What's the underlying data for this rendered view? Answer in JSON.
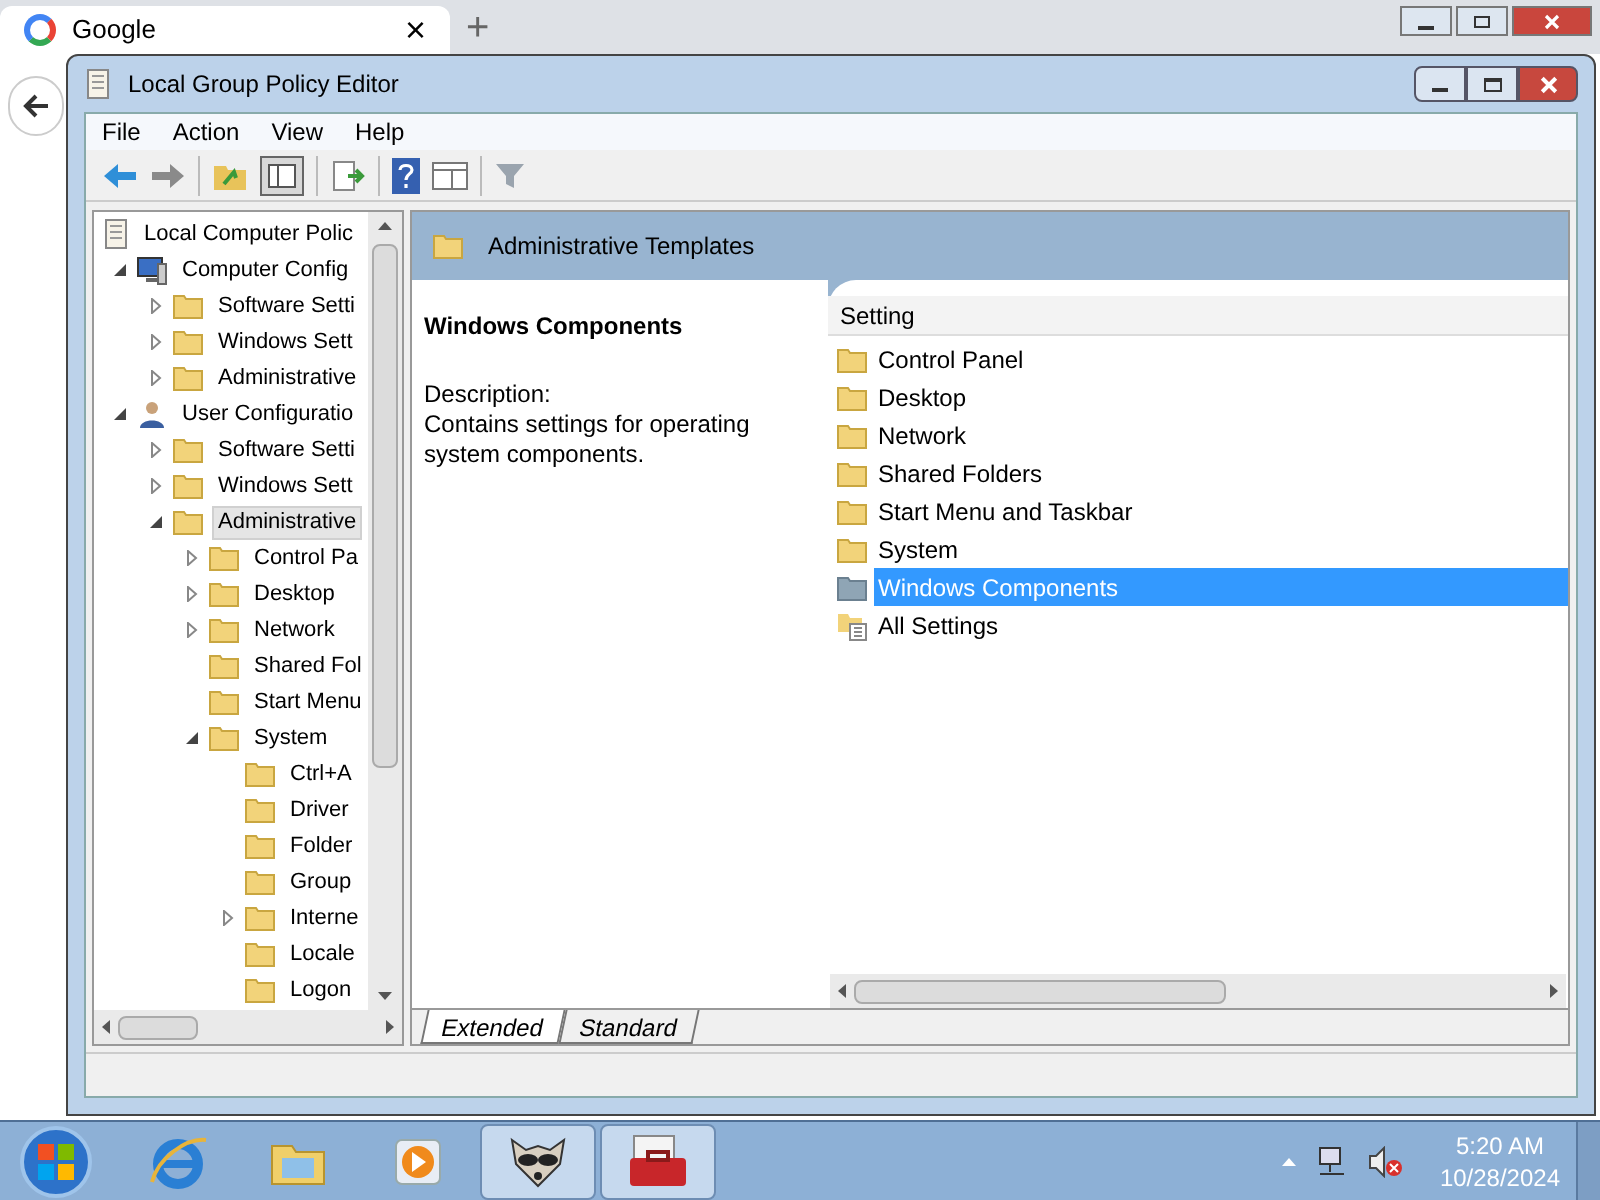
{
  "browser": {
    "tab_title": "Google",
    "tab_close": "×",
    "new_tab": "+"
  },
  "window": {
    "title": "Local Group Policy Editor"
  },
  "menu": [
    "File",
    "Action",
    "View",
    "Help"
  ],
  "tree": [
    {
      "label": "Local Computer Polic",
      "kind": "policy",
      "expandable": false,
      "selected": false,
      "children": [
        {
          "label": "Computer Config",
          "kind": "computer",
          "expandable": true,
          "expanded": true,
          "selected": false,
          "children": [
            {
              "label": "Software Setti",
              "kind": "folder",
              "expandable": true,
              "expanded": false,
              "selected": false
            },
            {
              "label": "Windows Sett",
              "kind": "folder",
              "expandable": true,
              "expanded": false,
              "selected": false
            },
            {
              "label": "Administrative",
              "kind": "folder",
              "expandable": true,
              "expanded": false,
              "selected": false
            }
          ]
        },
        {
          "label": "User Configuratio",
          "kind": "user",
          "expandable": true,
          "expanded": true,
          "selected": false,
          "children": [
            {
              "label": "Software Setti",
              "kind": "folder",
              "expandable": true,
              "expanded": false,
              "selected": false
            },
            {
              "label": "Windows Sett",
              "kind": "folder",
              "expandable": true,
              "expanded": false,
              "selected": false
            },
            {
              "label": "Administrative",
              "kind": "folder",
              "expandable": true,
              "expanded": true,
              "selected": true,
              "children": [
                {
                  "label": "Control Pa",
                  "kind": "folder",
                  "expandable": true,
                  "expanded": false,
                  "selected": false
                },
                {
                  "label": "Desktop",
                  "kind": "folder",
                  "expandable": true,
                  "expanded": false,
                  "selected": false
                },
                {
                  "label": "Network",
                  "kind": "folder",
                  "expandable": true,
                  "expanded": false,
                  "selected": false
                },
                {
                  "label": "Shared Fol",
                  "kind": "folder",
                  "expandable": false,
                  "selected": false
                },
                {
                  "label": "Start Menu",
                  "kind": "folder",
                  "expandable": false,
                  "selected": false
                },
                {
                  "label": "System",
                  "kind": "folder",
                  "expandable": true,
                  "expanded": true,
                  "selected": false,
                  "children": [
                    {
                      "label": "Ctrl+A",
                      "kind": "folder",
                      "expandable": false,
                      "selected": false
                    },
                    {
                      "label": "Driver",
                      "kind": "folder",
                      "expandable": false,
                      "selected": false
                    },
                    {
                      "label": "Folder",
                      "kind": "folder",
                      "expandable": false,
                      "selected": false
                    },
                    {
                      "label": "Group",
                      "kind": "folder",
                      "expandable": false,
                      "selected": false
                    },
                    {
                      "label": "Interne",
                      "kind": "folder",
                      "expandable": true,
                      "expanded": false,
                      "selected": false
                    },
                    {
                      "label": "Locale",
                      "kind": "folder",
                      "expandable": false,
                      "selected": false
                    },
                    {
                      "label": "Logon",
                      "kind": "folder",
                      "expandable": false,
                      "selected": false
                    }
                  ]
                }
              ]
            }
          ]
        }
      ]
    }
  ],
  "header": {
    "title": "Administrative Templates"
  },
  "details": {
    "title": "Windows Components",
    "description_label": "Description:",
    "description": "Contains settings for operating system components."
  },
  "list": {
    "column": "Setting",
    "items": [
      {
        "label": "Control Panel",
        "kind": "folder",
        "selected": false
      },
      {
        "label": "Desktop",
        "kind": "folder",
        "selected": false
      },
      {
        "label": "Network",
        "kind": "folder",
        "selected": false
      },
      {
        "label": "Shared Folders",
        "kind": "folder",
        "selected": false
      },
      {
        "label": "Start Menu and Taskbar",
        "kind": "folder",
        "selected": false
      },
      {
        "label": "System",
        "kind": "folder",
        "selected": false
      },
      {
        "label": "Windows Components",
        "kind": "folder",
        "selected": true
      },
      {
        "label": "All Settings",
        "kind": "settings",
        "selected": false
      }
    ]
  },
  "view_tabs": [
    {
      "label": "Extended",
      "selected": true
    },
    {
      "label": "Standard",
      "selected": false
    }
  ],
  "taskbar": {
    "apps": [
      {
        "kind": "ie",
        "active": false
      },
      {
        "kind": "explorer",
        "active": false
      },
      {
        "kind": "media",
        "active": false
      },
      {
        "kind": "raccoon",
        "active": true
      },
      {
        "kind": "toolbox",
        "active": true
      }
    ],
    "time": "5:20 AM",
    "date": "10/28/2024"
  }
}
